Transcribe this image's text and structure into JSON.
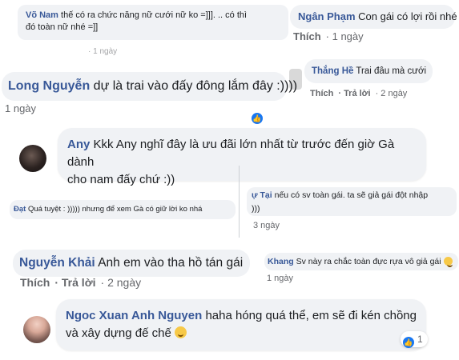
{
  "comments": [
    {
      "id": "c1",
      "name": "Võ Nam",
      "text_line1": "thế có ra chức năng nữ cưới nữ ko =]]]. .. có thì",
      "text_line2": "đó toàn nữ nhé =]]",
      "meta": "· 1 ngày"
    },
    {
      "id": "c2",
      "name": "Ngân Phạm",
      "text": "Con gái có lợi rồi nhé",
      "like": "Thích",
      "time": "· 1 ngày"
    },
    {
      "id": "c3",
      "name": "Thắng Hề",
      "text": "Trai đâu mà cưới",
      "like": "Thích",
      "reply": "· Trả lời",
      "time": "· 2 ngày"
    },
    {
      "id": "c4",
      "name": "Long Nguyễn",
      "text": "dự là trai vào đấy đông lắm đây :))))",
      "time": "1 ngày"
    },
    {
      "id": "c5",
      "name": "Any",
      "text_line1": "Kkk Any nghĩ đây là ưu đãi lớn nhất từ trước đến giờ Gà dành",
      "text_line2": "cho nam đấy chứ :))"
    },
    {
      "id": "c6",
      "name": "Đạt",
      "text": "Quá tuyệt : ))))) nhưng để xem Gà có giữ lời ko nhá"
    },
    {
      "id": "c7",
      "name": "ự Tại",
      "text_line1": "nếu có sv toàn gái. ta sẽ giả gái đột nhập",
      "text_line2": ")))",
      "time": "3 ngày"
    },
    {
      "id": "c8",
      "name": "Nguyễn Khải",
      "text": "Anh em vào tha hồ tán gái",
      "like": "Thích",
      "reply": "· Trả lời",
      "time": "· 2 ngày"
    },
    {
      "id": "c9",
      "name": "Khang",
      "text": "Sv này ra chắc toàn đực rựa vô giả gái",
      "time": "1 ngày"
    },
    {
      "id": "c10",
      "name": "Ngoc Xuan Anh Nguyen",
      "text_line1": "haha hóng quá thể, em sẽ đi kén chồng",
      "text_line2": "và xây dựng đế chế",
      "reactions": "1"
    }
  ],
  "icons": {
    "like": "like-icon",
    "emoji": "smile-emoji-icon"
  },
  "colors": {
    "name": "#385898",
    "bubble": "#f0f2f5",
    "meta": "#65676b",
    "like_badge": "#1877f2"
  }
}
